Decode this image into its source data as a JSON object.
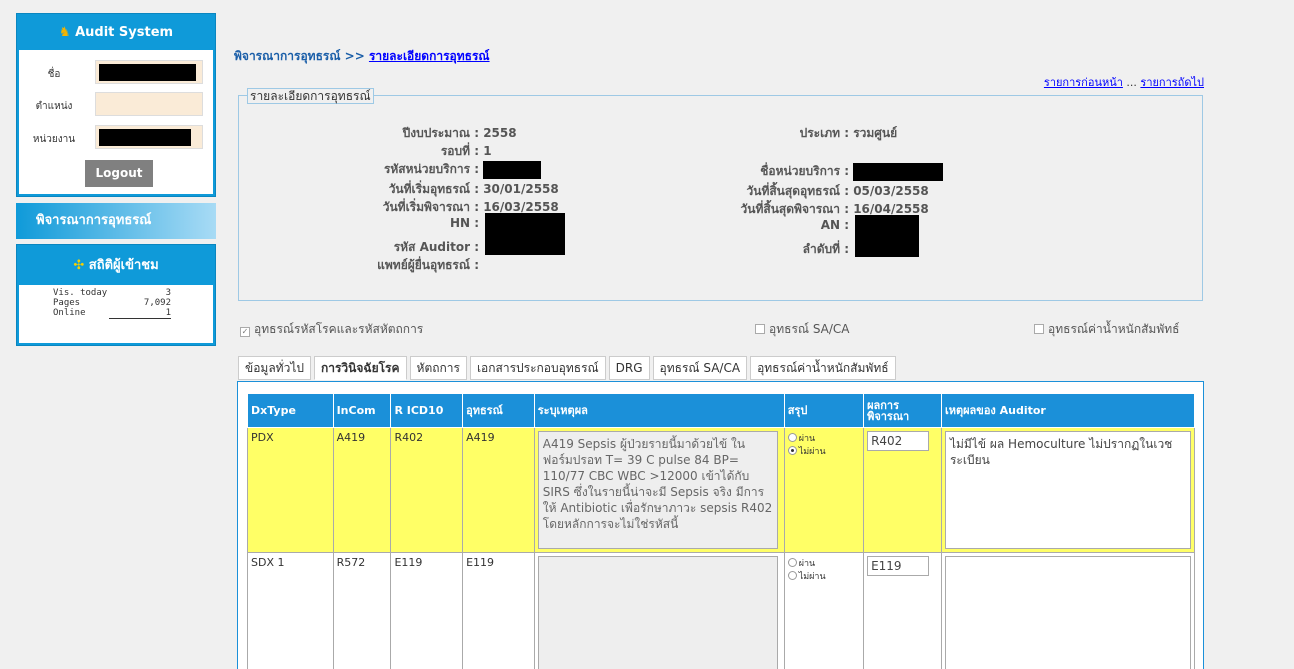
{
  "sidebar": {
    "title": "Audit System",
    "fields": [
      {
        "label": "ชื่อ",
        "value": ""
      },
      {
        "label": "ตำแหน่ง",
        "value": ""
      },
      {
        "label": "หน่วยงาน",
        "value": ""
      }
    ],
    "logout_label": "Logout",
    "nav_label": "พิจารณาการอุทธรณ์",
    "stats_title": "สถิติผู้เข้าชม",
    "stats": [
      {
        "key": "Vis. today",
        "value": "3"
      },
      {
        "key": "Pages",
        "value": "7,092"
      },
      {
        "key": "Online",
        "value": "1"
      }
    ],
    "accent": "#0f9ad9"
  },
  "breadcrumb": {
    "parent": "พิจารณาการอุทธรณ์",
    "sep": " >> ",
    "current": "รายละเอียดการอุทธรณ์"
  },
  "pager": {
    "prev": "รายการก่อนหน้า",
    "sep": " ... ",
    "next": "รายการถัดไป"
  },
  "detail": {
    "legend": "รายละเอียดการอุทธรณ์",
    "left": [
      {
        "label": "ปีงบประมาณ :",
        "value": "2558"
      },
      {
        "label": "รอบที่ :",
        "value": "1"
      },
      {
        "label": "รหัสหน่วยบริการ :",
        "value": ""
      },
      {
        "label": "วันที่เริ่มอุทธรณ์ :",
        "value": "30/01/2558"
      },
      {
        "label": "วันที่เริ่มพิจารณา :",
        "value": "16/03/2558"
      },
      {
        "label": "HN :",
        "value": ""
      },
      {
        "label": "รหัส Auditor :",
        "value": ""
      },
      {
        "label": "แพทย์ผู้ยื่นอุทธรณ์ :",
        "value": ""
      }
    ],
    "right": [
      {
        "label": "ประเภท :",
        "value": "รวมศูนย์"
      },
      {
        "label": "ชื่อหน่วยบริการ :",
        "value": ""
      },
      {
        "label": "วันที่สิ้นสุดอุทธรณ์ :",
        "value": "05/03/2558"
      },
      {
        "label": "วันที่สิ้นสุดพิจารณา :",
        "value": "16/04/2558"
      },
      {
        "label": "AN :",
        "value": ""
      },
      {
        "label": "ลำดับที่ :",
        "value": ""
      }
    ]
  },
  "checks": [
    {
      "label": "อุทธรณ์รหัสโรคและรหัสหัตถการ",
      "checked": true
    },
    {
      "label": "อุทธรณ์ SA/CA",
      "checked": false
    },
    {
      "label": "อุทธรณ์ค่าน้ำหนักสัมพัทธ์",
      "checked": false
    }
  ],
  "tabs": [
    {
      "label": "ข้อมูลทั่วไป",
      "active": false
    },
    {
      "label": "การวินิจฉัยโรค",
      "active": true
    },
    {
      "label": "หัตถการ",
      "active": false
    },
    {
      "label": "เอกสารประกอบอุทธรณ์",
      "active": false
    },
    {
      "label": "DRG",
      "active": false
    },
    {
      "label": "อุทธรณ์ SA/CA",
      "active": false
    },
    {
      "label": "อุทธรณ์ค่าน้ำหนักสัมพัทธ์",
      "active": false
    }
  ],
  "table": {
    "headers": [
      "DxType",
      "InCom",
      "R ICD10",
      "อุทธรณ์",
      "ระบุเหตุผล",
      "สรุป",
      "ผลการพิจารณา",
      "เหตุผลของ Auditor"
    ],
    "radio_labels": [
      "ผ่าน",
      "ไม่ผ่าน"
    ],
    "rows": [
      {
        "dxtype": "PDX",
        "incom": "A419",
        "ricd10": "R402",
        "appeal": "A419",
        "reason": "A419 Sepsis ผู้ป่วยรายนี้มาด้วยไข้ ในฟอร์มปรอท T= 39 C pulse 84 BP= 110/77 CBC WBC >12000 เข้าได้กับ SIRS ซึ่งในรายนี้น่าจะมี Sepsis จริง มีการให้ Antibiotic เพื่อรักษาภาวะ sepsis R402 โดยหลักการจะไม่ใช่รหัสนี้",
        "selected": "ไม่ผ่าน",
        "result": "R402",
        "auditor": "ไม่มีไข้ ผล Hemoculture ไม่ปรากฏในเวชระเบียน",
        "highlight": "#ffff66"
      },
      {
        "dxtype": "SDX 1",
        "incom": "R572",
        "ricd10": "E119",
        "appeal": "E119",
        "reason": "",
        "selected": "",
        "result": "E119",
        "auditor": ""
      }
    ]
  },
  "colors": {
    "header_blue": "#1b90d9",
    "link": "#0000ff"
  }
}
